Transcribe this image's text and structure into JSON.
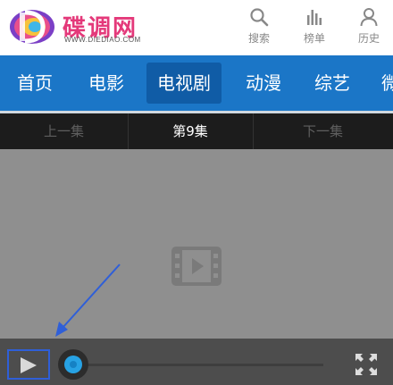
{
  "brand": {
    "name": "碟调网",
    "url": "WWW.DIEDIAO.COM",
    "colors": {
      "pink": "#e4397a",
      "nav_blue": "#1b76c7",
      "nav_active": "#105ca6",
      "progress": "#27a2e4",
      "highlight_box": "#2f5fd8"
    }
  },
  "header": {
    "actions": [
      {
        "label": "搜索",
        "icon": "search-icon"
      },
      {
        "label": "榜单",
        "icon": "ranking-icon"
      },
      {
        "label": "历史",
        "icon": "user-icon"
      }
    ]
  },
  "nav": {
    "items": [
      {
        "label": "首页"
      },
      {
        "label": "电影"
      },
      {
        "label": "电视剧",
        "active": true
      },
      {
        "label": "动漫"
      },
      {
        "label": "综艺"
      },
      {
        "label": "微"
      }
    ]
  },
  "episodes": {
    "prev_label": "上一集",
    "current_label": "第9集",
    "next_label": "下一集"
  },
  "player": {
    "placeholder_icon": "video-placeholder-icon",
    "play_icon": "play-icon",
    "fullscreen_icon": "fullscreen-icon",
    "progress": 0
  }
}
